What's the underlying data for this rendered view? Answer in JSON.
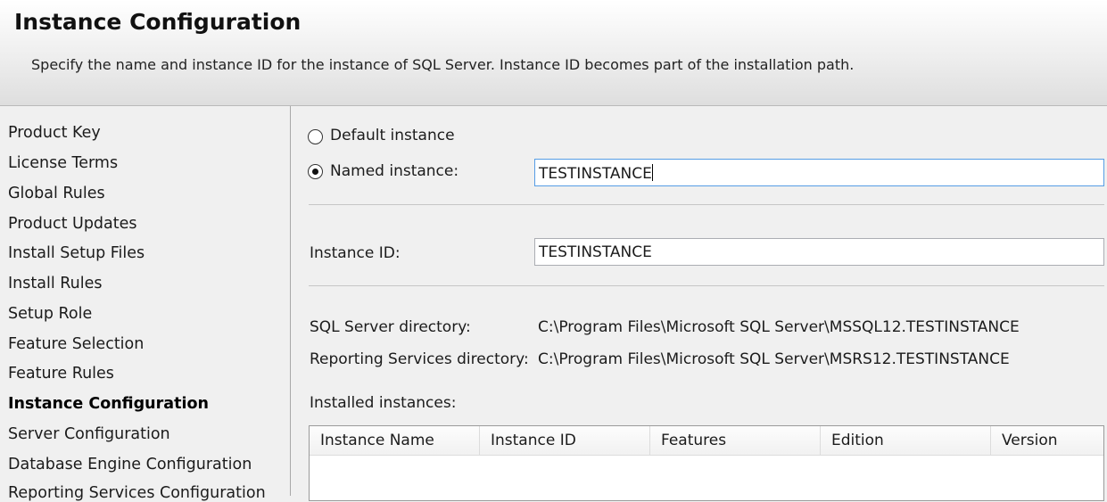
{
  "header": {
    "title": "Instance Configuration",
    "subtitle": "Specify the name and instance ID for the instance of SQL Server. Instance ID becomes part of the installation path."
  },
  "sidebar": {
    "items": [
      {
        "label": "Product Key"
      },
      {
        "label": "License Terms"
      },
      {
        "label": "Global Rules"
      },
      {
        "label": "Product Updates"
      },
      {
        "label": "Install Setup Files"
      },
      {
        "label": "Install Rules"
      },
      {
        "label": "Setup Role"
      },
      {
        "label": "Feature Selection"
      },
      {
        "label": "Feature Rules"
      },
      {
        "label": "Instance Configuration",
        "active": true
      },
      {
        "label": "Server Configuration"
      },
      {
        "label": "Database Engine Configuration"
      },
      {
        "label": "Reporting Services Configuration"
      }
    ]
  },
  "main": {
    "default_instance_label": "Default instance",
    "named_instance_label": "Named instance:",
    "selected_option": "named",
    "named_instance_value": "TESTINSTANCE",
    "instance_id_label": "Instance ID:",
    "instance_id_value": "TESTINSTANCE",
    "sql_server_dir_label": "SQL Server directory:",
    "sql_server_dir_value": "C:\\Program Files\\Microsoft SQL Server\\MSSQL12.TESTINSTANCE",
    "rs_dir_label": "Reporting Services directory:",
    "rs_dir_value": "C:\\Program Files\\Microsoft SQL Server\\MSRS12.TESTINSTANCE",
    "installed_instances_label": "Installed instances:",
    "table": {
      "columns": [
        "Instance Name",
        "Instance ID",
        "Features",
        "Edition",
        "Version"
      ],
      "rows": []
    }
  },
  "colors": {
    "focus_border": "#569de5",
    "header_gradient_top": "#ffffff",
    "header_gradient_bottom": "#dedede"
  }
}
